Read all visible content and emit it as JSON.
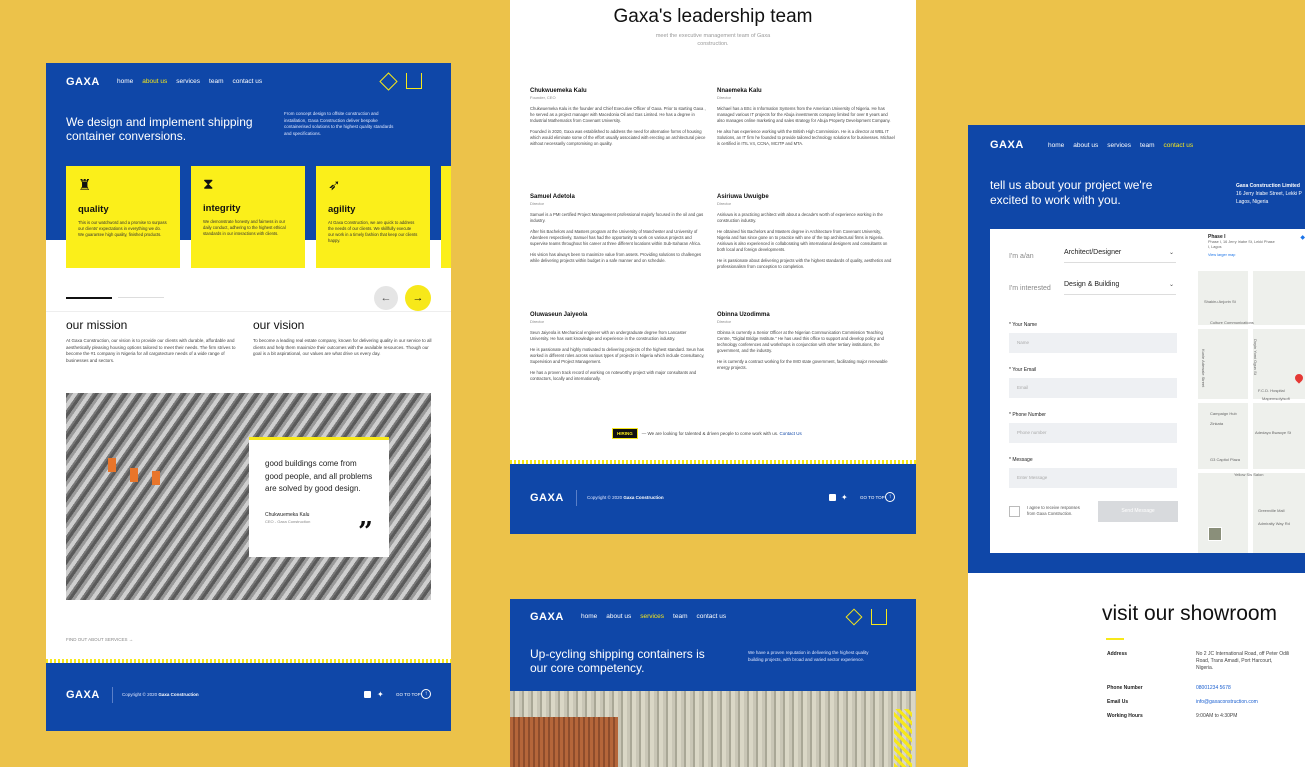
{
  "about": {
    "logo": "GAXA",
    "nav": [
      "home",
      "about us",
      "services",
      "team",
      "contact us"
    ],
    "hero_title": "We design and implement shipping container conversions.",
    "hero_text": "From concept design to offsite construction and installation, Gaxa Construction deliver bespoke containerised solutions to the highest quality standards and specifications.",
    "cards": [
      {
        "title": "quality",
        "text": "This is our watchword and a promise to surpass our clients' expectations in everything we do. We guarantee high quality, finished products.",
        "icon": "rook-icon"
      },
      {
        "title": "integrity",
        "text": "We demonstrate honesty and fairness in our daily conduct, adhering to the highest ethical standards in our interactions with clients.",
        "icon": "tie-icon"
      },
      {
        "title": "agility",
        "text": "At Gaxa Construction, we are quick to address the needs of our clients. We skillfully execute our work in a timely fashion that keep our clients happy.",
        "icon": "rocket-icon"
      }
    ],
    "mission_title": "our mission",
    "mission_text": "At Gaxa Construction, our vision is to provide our clients with durable, affordable and aesthetically pleasing housing options tailored to meet their needs. The firm strives to become the #1 company in Nigeria for all cargotecture needs of a wide range of businesses and sectors.",
    "vision_title": "our vision",
    "vision_text": "To become a leading real estate company, known for delivering quality in our service to all clients and help them maximize their outcomes with the available resources. Though our goal is a bit aspirational, our values are what drive us every day.",
    "quote": "good buildings come from good people, and all problems are solved by good design.",
    "quote_author": "Chukwuemeka Kalu",
    "quote_role": "CEO - Gaxa Construction",
    "find_more": "FIND OUT ABOUT SERVICES",
    "footer_copy": "Copyright © 2020",
    "footer_brand": "Gaxa Construction",
    "go_top": "GO TO TOP"
  },
  "team": {
    "title": "Gaxa's leadership team",
    "subtitle": "meet the executive management team of Gaxa construction.",
    "people": [
      {
        "name": "Chukwuemeka Kalu",
        "role": "Founder, CEO",
        "p": [
          "Chukwuemeka Kalu is the founder and Chief Executive Officer of Gaxa. Prior to starting Gaxa , he served as a project manager with Macedonia Oil and Gas Limited. He has a degree in Industrial Mathematics from Covenant University.",
          "Founded in 2020, Gaxa was established to address the need for alternative forms of housing which would eliminate some of the effort usually associated with erecting an architectural piece without necessarily compromising on quality."
        ]
      },
      {
        "name": "Nnaemeka Kalu",
        "role": "Director",
        "p": [
          "Michael has a BSc in Information Systems from the American University of Nigeria. He has managed various IT projects for the Abuja investments company limited for over 8 years and also manages online marketing and sales strategy for Abuja Property Development Company.",
          "He also has experience working with the British High Commission. He is a director at WBL IT Solutions, an IT firm he founded to provide tailored technology solutions for businesses. Michael is certified in ITIL V4, CCNA, MCITP and MTA."
        ]
      },
      {
        "name": "Samuel Adetola",
        "role": "Director",
        "p": [
          "Samuel is a PMI certified Project Management professional majorly focused in the oil and gas industry.",
          "After his Bachelors and Masters program at the University of Manchester and University of Aberdeen respectively, Samuel has had the opportunity to work on various projects and supervise teams throughout his career at three different locations within Sub-Saharan Africa.",
          "His vision has always been to maximize value from assets. Providing solutions to challenges while delivering projects within budget in a safe manner and on schedule."
        ]
      },
      {
        "name": "Asiriuwa Uwuigbe",
        "role": "Director",
        "p": [
          "Asiriuwa is a practicing architect with about a decade's worth of experience working in the construction industry.",
          "He obtained his Bachelors and Masters degree in Architecture from Covenant University, Nigeria and has since gone on to practice with one of the top architectural firms in Nigeria. Asiriuwa is also experienced in collaborating with international designers and consultants on both local and foreign developments.",
          "He is passionate about delivering projects with the highest standards of quality, aesthetics and professionalism from conception to completion."
        ]
      },
      {
        "name": "Oluwaseun Jaiyeola",
        "role": "Director",
        "p": [
          "Seun Jaiyeola is Mechanical engineer with an undergraduate degree from Lancaster University. He has vast knowledge and experience in the construction industry.",
          "He is passionate and highly motivated to delivering projects of the highest standard. Seun has worked in different roles across various types of projects in Nigeria which include Consultancy, Supervision and Project Management.",
          "He has a proven track record of working on noteworthy project with major consultants and contractors, locally and internationally."
        ]
      },
      {
        "name": "Obinna Uzodimma",
        "role": "Director",
        "p": [
          "Obinna is currently a Senior Officer at the Nigerian Communication Commission Teaching Centre, \"Digital Bridge Institute.\" He has used this office to support and develop policy and technology conferences and workshops in conjunction with other tertiary institutions, the government, and the industry.",
          "He is currently a contract working for the IMO state government, facilitating major renewable energy projects."
        ]
      }
    ],
    "hiring_badge": "HIRING",
    "hiring_text": "— We are looking for talented & driven people to come work with us.",
    "hiring_link": "Contact Us",
    "footer_copy": "Copyright © 2020",
    "footer_brand": "Gaxa Construction",
    "go_top": "GO TO TOP",
    "logo": "GAXA"
  },
  "services": {
    "logo": "GAXA",
    "nav": [
      "home",
      "about us",
      "services",
      "team",
      "contact us"
    ],
    "hero_title": "Up-cycling shipping containers is our core competency.",
    "hero_text": "We have a proven reputation in delivering the highest quality building projects, with broad and varied sector experience."
  },
  "contact": {
    "logo": "GAXA",
    "nav": [
      "home",
      "about us",
      "services",
      "team",
      "contact us"
    ],
    "hero_title": "tell us about your project we're excited to work with you.",
    "address_head": "Gaxa Construction Limited",
    "address_l1": "16 Jerry Iriabe Street, Lekki P",
    "address_l2": "Lagos, Nigeria",
    "i_am_label": "I'm a/an",
    "i_am_value": "Architect/Designer",
    "interest_label": "I'm interested",
    "interest_value": "Design & Building",
    "name_label": "* Your Name",
    "name_ph": "Name",
    "email_label": "* Your Email",
    "email_ph": "Email",
    "phone_label": "* Phone Number",
    "phone_ph": "Phone number",
    "message_label": "* Message",
    "message_ph": "Enter Message",
    "consent": "I agree to receive responses from Gaxa Construction.",
    "send": "Send Message",
    "map_title": "Phase I",
    "map_addr": "Phase I, 16 Jerry Iriabe St, Lekki Phase I, Lagos",
    "map_link": "View larger map",
    "map_labels": [
      "Shakiru Anjorin St",
      "Culture Communications",
      "F.C.D. Hospital",
      "Mapemsolyisoft",
      "Campaign Hub",
      "Zinkata",
      "Adedayo Bwaoye St",
      "G3 Capitol Plaza",
      "Yellow Sis Salon",
      "Greenville Mall",
      "Admiralty Way Rd",
      "Kunle Adewale Street",
      "Doyin Yomi Ogun St"
    ],
    "showroom_title": "visit our showroom",
    "info": [
      {
        "k": "Address",
        "v": "No 2 JC International Road, off Peter Odili Road, Trans Amadi, Port Harcourt, Nigeria."
      },
      {
        "k": "Phone Number",
        "v": "08001234 5678"
      },
      {
        "k": "Email Us",
        "v": "info@gaxaconstruction.com"
      },
      {
        "k": "Working Hours",
        "v": "9:00AM to 4:30PM"
      }
    ]
  }
}
